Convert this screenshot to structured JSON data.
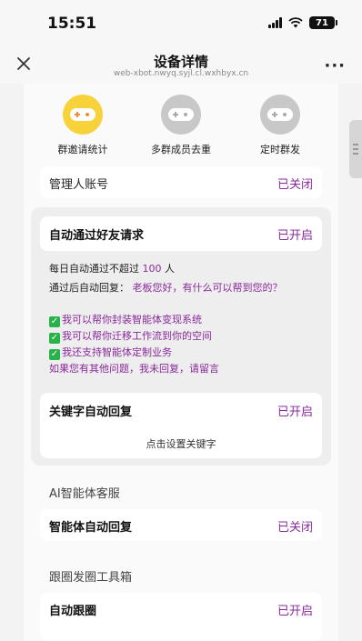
{
  "status_bar": {
    "time": "15:51",
    "battery": "71"
  },
  "nav": {
    "title": "设备详情",
    "subtitle": "web-xbot.nwyq.syjl.cl.wxhbyx.cn"
  },
  "tools": [
    {
      "label": "群邀请统计",
      "icon": "gamepad-icon",
      "color": "#f7d23b"
    },
    {
      "label": "多群成员去重",
      "icon": "gamepad-icon",
      "color": "#c8c8c8"
    },
    {
      "label": "定时群发",
      "icon": "gamepad-icon",
      "color": "#c8c8c8"
    }
  ],
  "admin": {
    "label": "管理人账号",
    "state": "已关闭"
  },
  "auto_friend": {
    "label": "自动通过好友请求",
    "state": "已开启",
    "daily_prefix": "每日自动通过不超过",
    "daily_count": "100",
    "daily_unit": "人",
    "reply_prefix": "通过后自动回复：",
    "reply_greeting": "老板您好，有什么可以帮到您的？",
    "reply_lines": [
      "我可以帮你封装智能体变现系统",
      "我可以帮你迁移工作流到你的空间",
      "我还支持智能体定制业务"
    ],
    "reply_closing": "如果您有其他问题，我未回复，请留言"
  },
  "keyword": {
    "label": "关键字自动回复",
    "state": "已开启",
    "link": "点击设置关键字"
  },
  "ai_section": {
    "title": "AI智能体客服",
    "label": "智能体自动回复",
    "state": "已关闭"
  },
  "moments_section": {
    "title": "跟圈发圈工具箱",
    "label": "自动跟圈",
    "state": "已开启"
  },
  "colors": {
    "accent": "#8a2a9c",
    "yellow": "#f7d23b",
    "check_green": "#27b34a"
  }
}
